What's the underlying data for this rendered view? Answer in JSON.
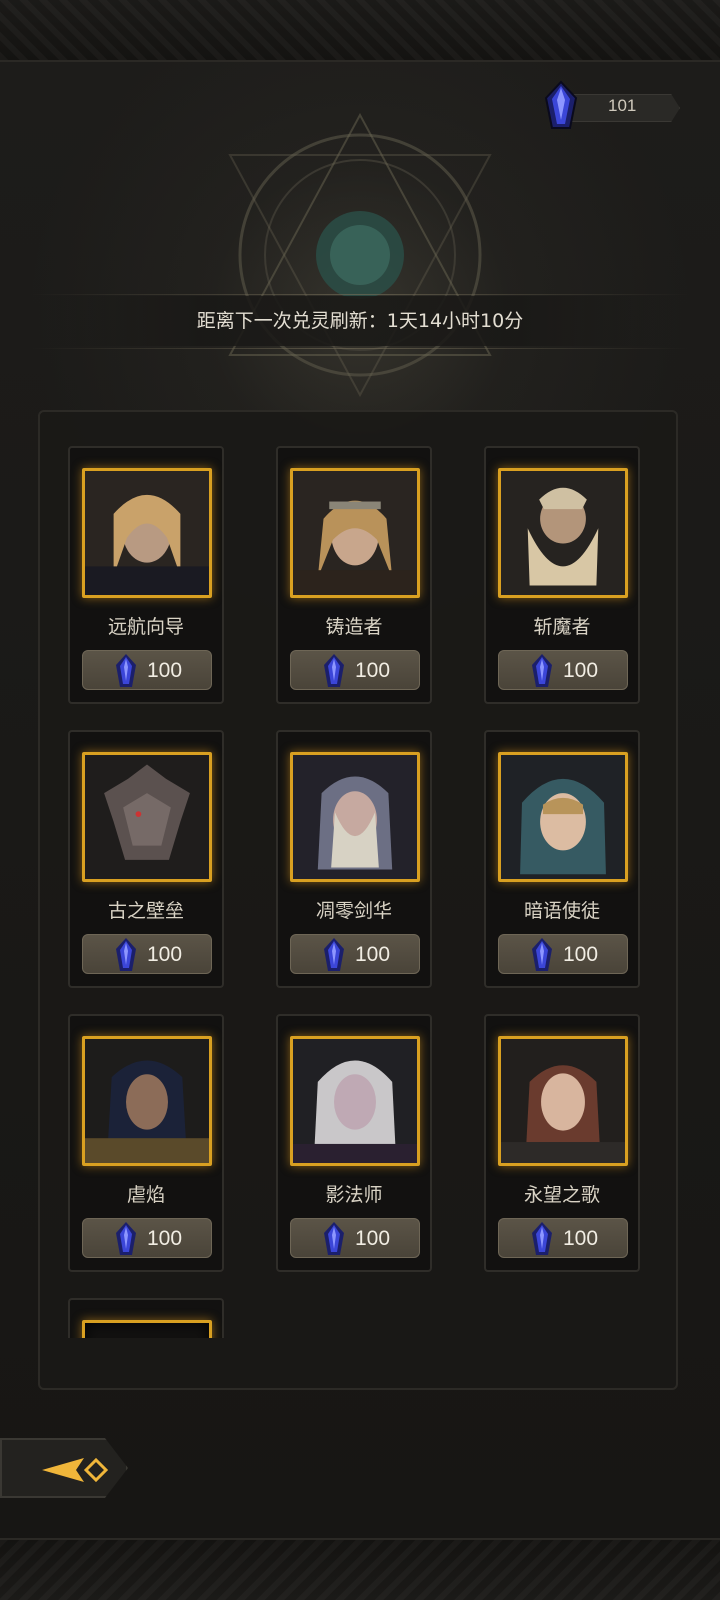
{
  "currency": {
    "icon": "blue-crystal-icon",
    "amount": "101"
  },
  "refresh": {
    "text": "距离下一次兑灵刷新：1天14小时10分"
  },
  "accent": "#d9a021",
  "cards": [
    {
      "name": "远航向导",
      "price": "100"
    },
    {
      "name": "铸造者",
      "price": "100"
    },
    {
      "name": "斩魔者",
      "price": "100"
    },
    {
      "name": "古之壁垒",
      "price": "100"
    },
    {
      "name": "凋零剑华",
      "price": "100"
    },
    {
      "name": "暗语使徒",
      "price": "100"
    },
    {
      "name": "虐焰",
      "price": "100"
    },
    {
      "name": "影法师",
      "price": "100"
    },
    {
      "name": "永望之歌",
      "price": "100"
    }
  ],
  "back": {
    "icon": "back-arrow-icon"
  }
}
